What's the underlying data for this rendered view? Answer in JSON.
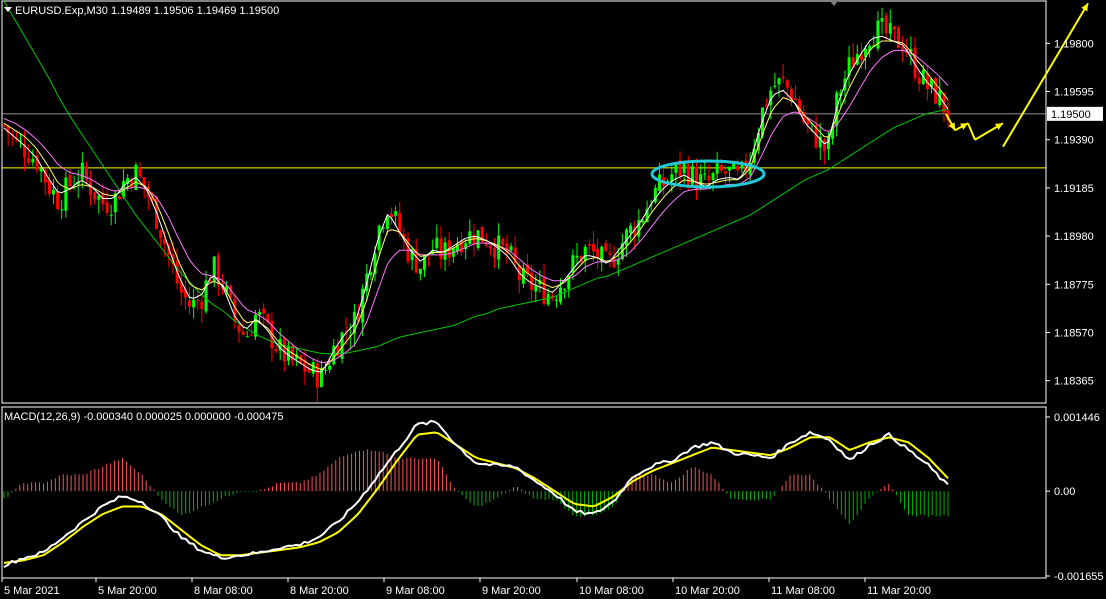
{
  "colors": {
    "background": "#000000",
    "frame": "#ffffff",
    "bull": "#00ff00",
    "bear": "#ff0000",
    "ma_fast": "#ffffff",
    "ma_mid": "#ffff66",
    "ma_slow": "#ff77ff",
    "ma_long": "#00c800",
    "hline_yellow": "#ffff00",
    "hline_price": "#c0c0c0",
    "ellipse": "#20c8d8",
    "arrow": "#ffff00",
    "macd_line": "#ffffff",
    "signal_line": "#ffff00",
    "hist_pos": "#ff5050",
    "hist_neg": "#00b400"
  },
  "main": {
    "title": "EURUSD.Exp,M30  1.19489 1.19506 1.19469 1.19500",
    "price_labels": [
      "1.19800",
      "1.19595",
      "1.19390",
      "1.19185",
      "1.18980",
      "1.18775",
      "1.18570",
      "1.18365"
    ],
    "current_price": "1.19500"
  },
  "macd": {
    "title": "MACD(12,26,9) -0.000340 0.000025 0.000000 -0.000475",
    "labels": [
      "0.001446",
      "0.00",
      "-0.001655"
    ]
  },
  "time_labels": [
    "5 Mar 2021",
    "5 Mar 20:00",
    "8 Mar 08:00",
    "8 Mar 20:00",
    "9 Mar 08:00",
    "9 Mar 20:00",
    "10 Mar 08:00",
    "10 Mar 20:00",
    "11 Mar 08:00",
    "11 Mar 20:00"
  ],
  "chart_data": {
    "type": "candlestick",
    "symbol": "EURUSD.Exp",
    "timeframe": "M30",
    "ylim": [
      1.1827,
      1.1998
    ],
    "x": [
      "5 Mar 2021",
      "5 Mar 20:00",
      "8 Mar 08:00",
      "8 Mar 20:00",
      "9 Mar 08:00",
      "9 Mar 20:00",
      "10 Mar 08:00",
      "10 Mar 20:00",
      "11 Mar 08:00",
      "11 Mar 20:00"
    ],
    "close_path": [
      1.1945,
      1.1938,
      1.1935,
      1.193,
      1.192,
      1.1913,
      1.192,
      1.1925,
      1.1918,
      1.1912,
      1.1913,
      1.1922,
      1.1925,
      1.1917,
      1.1905,
      1.189,
      1.1875,
      1.1868,
      1.1872,
      1.1885,
      1.1877,
      1.1862,
      1.1855,
      1.1865,
      1.1858,
      1.185,
      1.1845,
      1.1843,
      1.184,
      1.1838,
      1.185,
      1.1857,
      1.1862,
      1.188,
      1.19,
      1.1912,
      1.19,
      1.189,
      1.1885,
      1.1893,
      1.189,
      1.1895,
      1.1898,
      1.1899,
      1.1897,
      1.1893,
      1.189,
      1.188,
      1.1877,
      1.1875,
      1.1873,
      1.188,
      1.1887,
      1.1892,
      1.189,
      1.1885,
      1.1893,
      1.19,
      1.1905,
      1.1915,
      1.192,
      1.1925,
      1.1927,
      1.1922,
      1.192,
      1.1924,
      1.1925,
      1.1922,
      1.1932,
      1.195,
      1.1962,
      1.1963,
      1.1957,
      1.1945,
      1.194,
      1.1933,
      1.1958,
      1.197,
      1.1978,
      1.1985,
      1.1985,
      1.1982,
      1.198,
      1.197,
      1.1962,
      1.1958,
      1.195
    ],
    "ma_fast_path": [
      1.1944,
      1.194,
      1.1936,
      1.1931,
      1.1923,
      1.1916,
      1.1918,
      1.1922,
      1.1919,
      1.1914,
      1.1914,
      1.192,
      1.1923,
      1.1918,
      1.1907,
      1.1893,
      1.188,
      1.1871,
      1.1873,
      1.1882,
      1.1876,
      1.1864,
      1.1858,
      1.1863,
      1.1858,
      1.1851,
      1.1847,
      1.1844,
      1.1841,
      1.184,
      1.1849,
      1.1856,
      1.1861,
      1.1877,
      1.1896,
      1.1908,
      1.19,
      1.1892,
      1.1887,
      1.1892,
      1.1891,
      1.1894,
      1.1897,
      1.1898,
      1.1896,
      1.1893,
      1.1889,
      1.1882,
      1.1878,
      1.1876,
      1.1874,
      1.1879,
      1.1885,
      1.189,
      1.1889,
      1.1886,
      1.1892,
      1.1898,
      1.1904,
      1.1912,
      1.1918,
      1.1922,
      1.1924,
      1.1921,
      1.1919,
      1.1922,
      1.1923,
      1.1922,
      1.193,
      1.1946,
      1.1958,
      1.196,
      1.1955,
      1.1946,
      1.1941,
      1.1936,
      1.1955,
      1.1967,
      1.1975,
      1.1982,
      1.1983,
      1.1981,
      1.1979,
      1.1971,
      1.1964,
      1.1959,
      1.1952
    ],
    "ma_mid_path": [
      1.1946,
      1.1943,
      1.194,
      1.1935,
      1.1928,
      1.192,
      1.1918,
      1.192,
      1.1919,
      1.1916,
      1.1915,
      1.1918,
      1.1921,
      1.1919,
      1.1911,
      1.1899,
      1.1886,
      1.1877,
      1.1875,
      1.1879,
      1.1877,
      1.1868,
      1.1861,
      1.1862,
      1.1859,
      1.1853,
      1.1849,
      1.1846,
      1.1843,
      1.1841,
      1.1846,
      1.1852,
      1.1858,
      1.187,
      1.1887,
      1.1901,
      1.19,
      1.1894,
      1.1889,
      1.1891,
      1.1891,
      1.1893,
      1.1896,
      1.1897,
      1.1896,
      1.1894,
      1.1891,
      1.1885,
      1.1881,
      1.1878,
      1.1876,
      1.1878,
      1.1883,
      1.1888,
      1.1889,
      1.1887,
      1.189,
      1.1895,
      1.1901,
      1.1908,
      1.1914,
      1.1919,
      1.1922,
      1.1921,
      1.192,
      1.1921,
      1.1922,
      1.1922,
      1.1927,
      1.194,
      1.1952,
      1.1957,
      1.1955,
      1.1949,
      1.1944,
      1.1939,
      1.195,
      1.1961,
      1.197,
      1.1978,
      1.1981,
      1.1981,
      1.198,
      1.1974,
      1.1968,
      1.1962,
      1.1956
    ],
    "ma_slow_path": [
      1.1948,
      1.1946,
      1.1943,
      1.1939,
      1.1934,
      1.1928,
      1.1925,
      1.1924,
      1.1922,
      1.1919,
      1.1917,
      1.1918,
      1.1919,
      1.1918,
      1.1914,
      1.1906,
      1.1896,
      1.1887,
      1.1882,
      1.1881,
      1.1879,
      1.1873,
      1.1867,
      1.1865,
      1.1862,
      1.1857,
      1.1853,
      1.1849,
      1.1846,
      1.1844,
      1.1845,
      1.1848,
      1.1852,
      1.1861,
      1.1874,
      1.1887,
      1.1892,
      1.1892,
      1.189,
      1.189,
      1.189,
      1.1891,
      1.1893,
      1.1895,
      1.1895,
      1.1894,
      1.1892,
      1.1888,
      1.1884,
      1.1881,
      1.1879,
      1.1879,
      1.1881,
      1.1885,
      1.1887,
      1.1887,
      1.1888,
      1.1891,
      1.1896,
      1.1902,
      1.1908,
      1.1913,
      1.1917,
      1.1918,
      1.1918,
      1.1919,
      1.192,
      1.192,
      1.1923,
      1.1932,
      1.1942,
      1.1949,
      1.1951,
      1.1949,
      1.1946,
      1.1942,
      1.1946,
      1.1953,
      1.1961,
      1.1969,
      1.1974,
      1.1977,
      1.1977,
      1.1975,
      1.1971,
      1.1967,
      1.1962
    ],
    "ma_long_path": [
      1.1998,
      1.199,
      1.1982,
      1.1974,
      1.1966,
      1.1957,
      1.1949,
      1.1942,
      1.1935,
      1.1928,
      1.1921,
      1.1914,
      1.1907,
      1.1901,
      1.1895,
      1.1889,
      1.1883,
      1.1878,
      1.1873,
      1.1869,
      1.1866,
      1.1862,
      1.1859,
      1.1856,
      1.1854,
      1.1852,
      1.1851,
      1.185,
      1.1849,
      1.1848,
      1.1848,
      1.1848,
      1.1849,
      1.185,
      1.1851,
      1.1853,
      1.1855,
      1.1856,
      1.1857,
      1.1858,
      1.1859,
      1.186,
      1.1862,
      1.1864,
      1.1865,
      1.1867,
      1.1868,
      1.1869,
      1.187,
      1.1871,
      1.1872,
      1.1874,
      1.1876,
      1.1878,
      1.188,
      1.1881,
      1.1883,
      1.1885,
      1.1887,
      1.1889,
      1.1891,
      1.1893,
      1.1895,
      1.1897,
      1.1899,
      1.1901,
      1.1903,
      1.1905,
      1.1907,
      1.191,
      1.1913,
      1.1916,
      1.1919,
      1.1922,
      1.1924,
      1.1926,
      1.1929,
      1.1932,
      1.1935,
      1.1938,
      1.1941,
      1.1944,
      1.1946,
      1.1948,
      1.195,
      1.1951,
      1.1952
    ],
    "hlines": [
      1.195,
      1.1927
    ],
    "forecast_arrow_path": [
      1.195,
      1.1943,
      1.1946,
      1.1939,
      1.1946,
      1.1936,
      1.1997
    ],
    "macd_series": [
      -0.00145,
      -0.0013,
      -0.0012,
      -0.0009,
      -0.0006,
      -0.0003,
      -0.0001,
      -0.0002,
      -0.0005,
      -0.0009,
      -0.00115,
      -0.0013,
      -0.00125,
      -0.0012,
      -0.0011,
      -0.00105,
      -0.0009,
      -0.0006,
      -0.0002,
      0.0003,
      0.0008,
      0.0013,
      0.00135,
      0.0009,
      0.00055,
      0.0005,
      0.00048,
      0.0002,
      -5e-05,
      -0.0004,
      -0.00045,
      -0.0002,
      0.0003,
      0.0005,
      0.0006,
      0.00085,
      0.00095,
      0.00075,
      0.0007,
      0.00065,
      0.00095,
      0.00115,
      0.001,
      0.0006,
      0.0009,
      0.0011,
      0.0008,
      0.0005,
      0.0001
    ],
    "signal_series": [
      -0.0014,
      -0.00135,
      -0.00125,
      -0.001,
      -0.0007,
      -0.00045,
      -0.0003,
      -0.0003,
      -0.00045,
      -0.00075,
      -0.00105,
      -0.00125,
      -0.00125,
      -0.0012,
      -0.00115,
      -0.0011,
      -0.001,
      -0.0008,
      -0.00045,
      5e-05,
      0.0006,
      0.0011,
      0.00115,
      0.0009,
      0.00065,
      0.00055,
      0.00045,
      0.00025,
      0.0,
      -0.00025,
      -0.0003,
      -0.0001,
      0.0002,
      0.0004,
      0.00055,
      0.0007,
      0.00085,
      0.0008,
      0.00075,
      0.0007,
      0.00085,
      0.00105,
      0.00105,
      0.0008,
      0.00095,
      0.00105,
      0.00095,
      0.00065,
      0.00025
    ],
    "macd_ylim": [
      -0.001655,
      0.001446
    ]
  }
}
